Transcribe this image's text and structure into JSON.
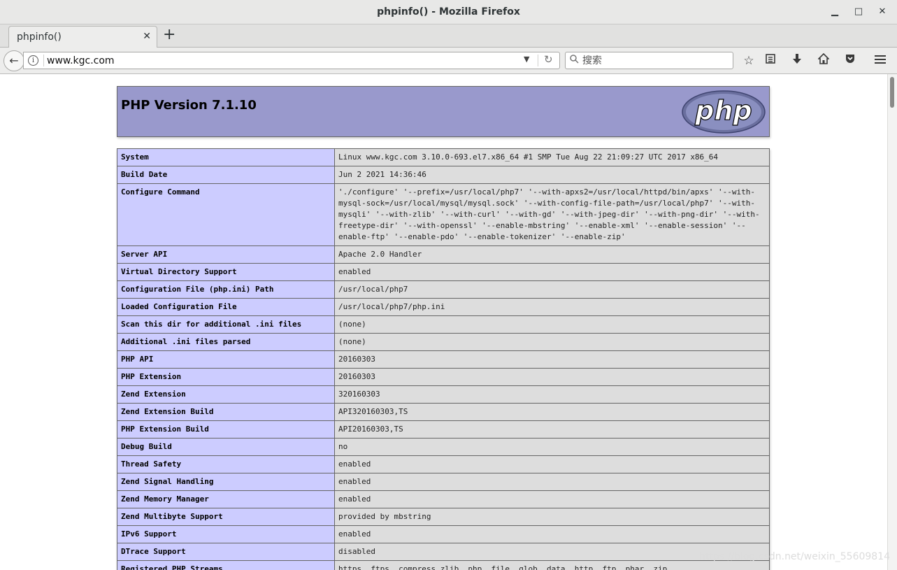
{
  "window": {
    "title": "phpinfo() - Mozilla Firefox",
    "minimize_glyph": "▁",
    "maximize_glyph": "□",
    "close_glyph": "✕"
  },
  "tabs": [
    {
      "label": "phpinfo()",
      "close_glyph": "✕"
    }
  ],
  "new_tab_glyph": "+",
  "navbar": {
    "url": "www.kgc.com",
    "search_placeholder": "搜索",
    "icons": [
      "back-arrow-icon",
      "site-info-icon",
      "dropdown-arrow-icon",
      "reload-icon",
      "search-icon",
      "bookmark-star-icon",
      "reading-list-icon",
      "download-icon",
      "home-icon",
      "pocket-icon",
      "hamburger-menu-icon"
    ]
  },
  "page": {
    "heading": "PHP Version 7.1.10",
    "logo_text": "php",
    "rows": [
      {
        "key": "System",
        "value": "Linux www.kgc.com 3.10.0-693.el7.x86_64 #1 SMP Tue Aug 22 21:09:27 UTC 2017 x86_64"
      },
      {
        "key": "Build Date",
        "value": "Jun 2 2021 14:36:46"
      },
      {
        "key": "Configure Command",
        "value": "'./configure' '--prefix=/usr/local/php7' '--with-apxs2=/usr/local/httpd/bin/apxs' '--with-mysql-sock=/usr/local/mysql/mysql.sock' '--with-config-file-path=/usr/local/php7' '--with-mysqli' '--with-zlib' '--with-curl' '--with-gd' '--with-jpeg-dir' '--with-png-dir' '--with-freetype-dir' '--with-openssl' '--enable-mbstring' '--enable-xml' '--enable-session' '--enable-ftp' '--enable-pdo' '--enable-tokenizer' '--enable-zip'"
      },
      {
        "key": "Server API",
        "value": "Apache 2.0 Handler"
      },
      {
        "key": "Virtual Directory Support",
        "value": "enabled"
      },
      {
        "key": "Configuration File (php.ini) Path",
        "value": "/usr/local/php7"
      },
      {
        "key": "Loaded Configuration File",
        "value": "/usr/local/php7/php.ini"
      },
      {
        "key": "Scan this dir for additional .ini files",
        "value": "(none)"
      },
      {
        "key": "Additional .ini files parsed",
        "value": "(none)"
      },
      {
        "key": "PHP API",
        "value": "20160303"
      },
      {
        "key": "PHP Extension",
        "value": "20160303"
      },
      {
        "key": "Zend Extension",
        "value": "320160303"
      },
      {
        "key": "Zend Extension Build",
        "value": "API320160303,TS"
      },
      {
        "key": "PHP Extension Build",
        "value": "API20160303,TS"
      },
      {
        "key": "Debug Build",
        "value": "no"
      },
      {
        "key": "Thread Safety",
        "value": "enabled"
      },
      {
        "key": "Zend Signal Handling",
        "value": "enabled"
      },
      {
        "key": "Zend Memory Manager",
        "value": "enabled"
      },
      {
        "key": "Zend Multibyte Support",
        "value": "provided by mbstring"
      },
      {
        "key": "IPv6 Support",
        "value": "enabled"
      },
      {
        "key": "DTrace Support",
        "value": "disabled"
      },
      {
        "key": "Registered PHP Streams",
        "value": "https, ftps, compress.zlib, php, file, glob, data, http, ftp, phar, zip"
      },
      {
        "key": "",
        "value": ""
      }
    ]
  },
  "watermark": "https://blog.csdn.net/weixin_55609814",
  "colors": {
    "php_header_bg": "#9999cc",
    "key_cell_bg": "#ccccff",
    "value_cell_bg": "#dddddd"
  }
}
